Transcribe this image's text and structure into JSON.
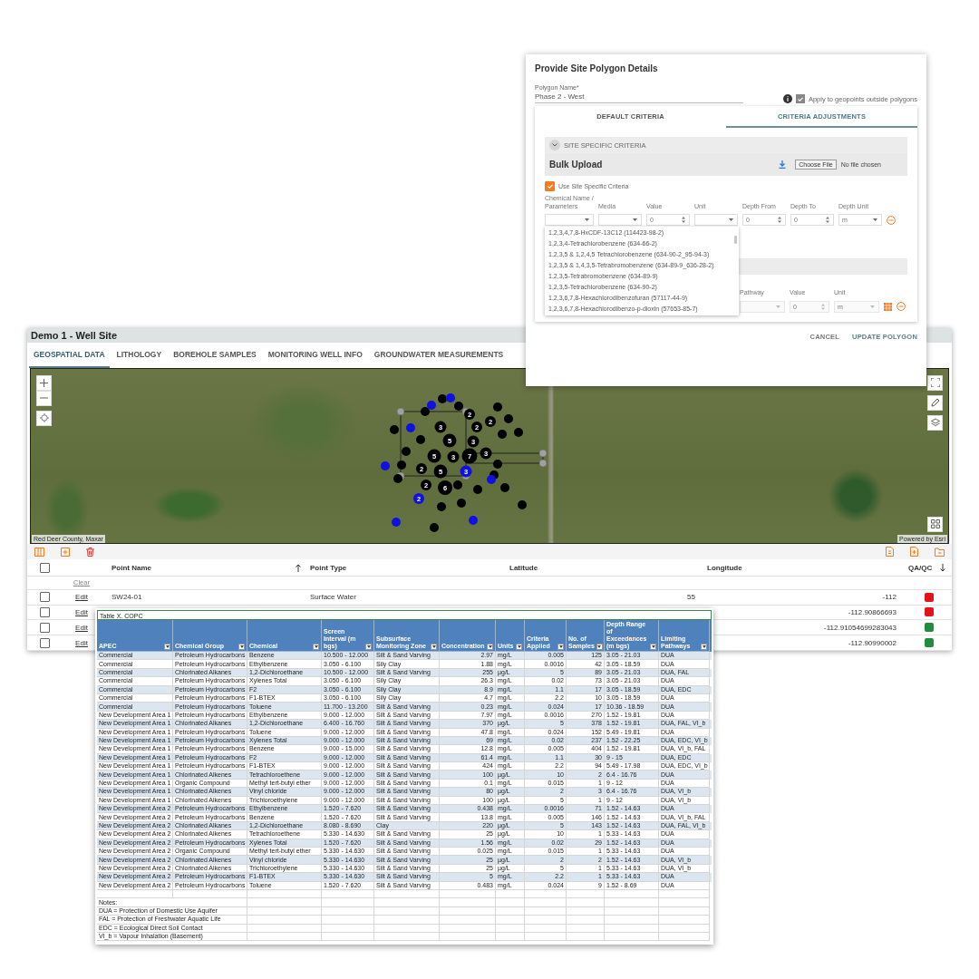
{
  "app": {
    "title": "Demo 1 - Well Site",
    "tabs": [
      {
        "label": "GEOSPATIAL DATA",
        "selected": true
      },
      {
        "label": "LITHOLOGY",
        "selected": false
      },
      {
        "label": "BOREHOLE SAMPLES",
        "selected": false
      },
      {
        "label": "MONITORING WELL INFO",
        "selected": false
      },
      {
        "label": "GROUNDWATER MEASUREMENTS",
        "selected": false
      }
    ],
    "map": {
      "attribution": "Red Deer County, Maxar",
      "credit": "Powered by Esri",
      "clusters": [
        {
          "count": "2",
          "color": "#000000"
        },
        {
          "count": "2",
          "color": "#000000"
        },
        {
          "count": "2",
          "color": "#000000"
        },
        {
          "count": "3",
          "color": "#000000"
        },
        {
          "count": "5",
          "color": "#000000"
        },
        {
          "count": "3",
          "color": "#000000"
        },
        {
          "count": "5",
          "color": "#000000"
        },
        {
          "count": "3",
          "color": "#000000"
        },
        {
          "count": "7",
          "color": "#000000"
        },
        {
          "count": "3",
          "color": "#000000"
        },
        {
          "count": "2",
          "color": "#000000"
        },
        {
          "count": "5",
          "color": "#000000"
        },
        {
          "count": "3",
          "color": "#1010e0"
        },
        {
          "count": "2",
          "color": "#000000"
        },
        {
          "count": "6",
          "color": "#000000"
        },
        {
          "count": "2",
          "color": "#1010e0"
        }
      ]
    },
    "table": {
      "select_all": {
        "checked": false
      },
      "columns": [
        "Point Name",
        "Point Type",
        "Latitude",
        "Longitude",
        "QA/QC"
      ],
      "filter_link": "Clear",
      "rows": [
        {
          "checked": false,
          "action": "Edit",
          "point_name": "SW24-01",
          "point_type": "Surface Water",
          "latitude": "55",
          "longitude": "-112",
          "color": "#e3131b"
        },
        {
          "checked": false,
          "action": "Edit",
          "longitude": "-112.90866693",
          "color": "#e3131b"
        },
        {
          "checked": false,
          "action": "Edit",
          "longitude": "-112.91054699283043",
          "color": "#1e8e3e"
        },
        {
          "checked": false,
          "action": "Edit",
          "longitude": "-112.90990002",
          "color": "#1e8e3e"
        }
      ]
    }
  },
  "dialog": {
    "title": "Provide Site Polygon Details",
    "polygon_name": {
      "label": "Polygon Name*",
      "value": "Phase 2 - West"
    },
    "apply_outside": {
      "label": "Apply to geopoints outside polygons",
      "checked": true
    },
    "tabs": [
      {
        "label": "DEFAULT CRITERIA",
        "selected": false
      },
      {
        "label": "CRITERIA ADJUSTMENTS",
        "selected": true
      }
    ],
    "section": {
      "title": "SITE SPECIFIC CRITERIA",
      "expanded": true
    },
    "bulk_upload": {
      "title": "Bulk Upload",
      "file_button": "Choose File",
      "file_status": "No file chosen"
    },
    "use_criteria": {
      "label": "Use Site Specific Criteria",
      "checked": true
    },
    "criteria_columns": [
      "Chemical Name / Parameters",
      "Media",
      "Value",
      "Unit",
      "Depth From",
      "Depth To",
      "Depth Unit"
    ],
    "criteria_row": {
      "value": "0",
      "depth_from": "0",
      "depth_to": "0",
      "depth_unit": "m"
    },
    "dropdown_options": [
      "1,2,3,4,7,8-HxCDF-13C12 (114423-98-2)",
      "1,2,3,4-Tetrachlorobenzene (634-66-2)",
      "1,2,3,5 & 1,2,4,5 Tetrachlorobenzene (634-90-2_95-94-3)",
      "1,2,3,5 & 1,4,3,5-Tetrabromobenzene (634-89-9_636-28-2)",
      "1,2,3,5-Tetrabromobenzene (634-89-9)",
      "1,2,3,5-Tetrachlorobenzene (634-90-2)",
      "1,2,3,6,7,8-Hexachlorodibenzofuran (57117-44-9)",
      "1,2,3,6,7,8-Hexachlorodibenzo-p-dioxin (57653-85-7)"
    ],
    "pathway_columns": [
      "Pathway",
      "Value",
      "Unit"
    ],
    "pathway_row": {
      "value": "0",
      "unit": "m"
    },
    "actions": [
      "CANCEL",
      "UPDATE POLYGON"
    ]
  },
  "spreadsheet": {
    "title": "Table X. COPC",
    "columns": [
      "APEC",
      "Chemical Group",
      "Chemical",
      "Screen Interval (m bgs)",
      "Subsurface Monitoring Zone",
      "Concentration",
      "Units",
      "Criteria Applied",
      "No. of Samples",
      "Depth Range of Exceedances (m bgs)",
      "Limiting Pathways"
    ],
    "rows": [
      [
        "Commercial",
        "Petroleum Hydrocarbons",
        "Benzene",
        "10.500 - 12.000",
        "Silt & Sand Varving",
        "2.97",
        "mg/L",
        "0.005",
        "125",
        "3.05 - 21.03",
        "DUA"
      ],
      [
        "Commercial",
        "Petroleum Hydrocarbons",
        "Ethylbenzene",
        "3.050 - 6.100",
        "Sily Clay",
        "1.88",
        "mg/L",
        "0.0016",
        "42",
        "3.05 - 18.59",
        "DUA"
      ],
      [
        "Commercial",
        "Chlorinated Alkanes",
        "1,2-Dichloroethane",
        "10.500 - 12.000",
        "Silt & Sand Varving",
        "255",
        "µg/L",
        "5",
        "89",
        "3.05 - 21.03",
        "DUA, FAL"
      ],
      [
        "Commercial",
        "Petroleum Hydrocarbons",
        "Xylenes Total",
        "3.050 - 6.100",
        "Sily Clay",
        "26.3",
        "mg/L",
        "0.02",
        "73",
        "3.05 - 21.03",
        "DUA"
      ],
      [
        "Commercial",
        "Petroleum Hydrocarbons",
        "F2",
        "3.050 - 6.100",
        "Sily Clay",
        "8.9",
        "mg/L",
        "1.1",
        "17",
        "3.05 - 18.59",
        "DUA, EDC"
      ],
      [
        "Commercial",
        "Petroleum Hydrocarbons",
        "F1-BTEX",
        "3.050 - 6.100",
        "Sily Clay",
        "4.7",
        "mg/L",
        "2.2",
        "10",
        "3.05 - 18.59",
        "DUA"
      ],
      [
        "Commercial",
        "Petroleum Hydrocarbons",
        "Toluene",
        "11.700 - 13.200",
        "Silt & Sand Varving",
        "0.23",
        "mg/L",
        "0.024",
        "17",
        "10.36 - 18.59",
        "DUA"
      ],
      [
        "New Development Area 1",
        "Petroleum Hydrocarbons",
        "Ethylbenzene",
        "9.000 - 12.000",
        "Silt & Sand Varving",
        "7.97",
        "mg/L",
        "0.0016",
        "270",
        "1.52 - 19.81",
        "DUA"
      ],
      [
        "New Development Area 1",
        "Chlorinated Alkanes",
        "1,2-Dichloroethane",
        "6.400 - 16.760",
        "Silt & Sand Varving",
        "370",
        "µg/L",
        "5",
        "378",
        "1.52 - 19.81",
        "DUA, FAL, VI_b"
      ],
      [
        "New Development Area 1",
        "Petroleum Hydrocarbons",
        "Toluene",
        "9.000 - 12.000",
        "Silt & Sand Varving",
        "47.8",
        "mg/L",
        "0.024",
        "152",
        "5.49 - 19.81",
        "DUA"
      ],
      [
        "New Development Area 1",
        "Petroleum Hydrocarbons",
        "Xylenes Total",
        "9.000 - 12.000",
        "Silt & Sand Varving",
        "69",
        "mg/L",
        "0.02",
        "237",
        "1.52 - 22.25",
        "DUA, EDC, VI_b"
      ],
      [
        "New Development Area 1",
        "Petroleum Hydrocarbons",
        "Benzene",
        "9.000 - 15.000",
        "Silt & Sand Varving",
        "12.8",
        "mg/L",
        "0.005",
        "404",
        "1.52 - 19.81",
        "DUA, VI_b, FAL"
      ],
      [
        "New Development Area 1",
        "Petroleum Hydrocarbons",
        "F2",
        "9.000 - 12.000",
        "Silt & Sand Varving",
        "61.4",
        "mg/L",
        "1.1",
        "30",
        "9 - 15",
        "DUA, EDC"
      ],
      [
        "New Development Area 1",
        "Petroleum Hydrocarbons",
        "F1-BTEX",
        "9.000 - 12.000",
        "Silt & Sand Varving",
        "424",
        "mg/L",
        "2.2",
        "94",
        "5.49 - 17.98",
        "DUA, EDC, VI_b"
      ],
      [
        "New Development Area 1",
        "Chlorinated Alkenes",
        "Tetrachloroethene",
        "9.000 - 12.000",
        "Silt & Sand Varving",
        "100",
        "µg/L",
        "10",
        "2",
        "6.4 - 16.76",
        "DUA"
      ],
      [
        "New Development Area 1",
        "Organic Compound",
        "Methyl tert-butyl ether",
        "9.000 - 12.000",
        "Silt & Sand Varving",
        "0.1",
        "mg/L",
        "0.015",
        "1",
        "9 - 12",
        "DUA"
      ],
      [
        "New Development Area 1",
        "Chlorinated Alkenes",
        "Vinyl chloride",
        "9.000 - 12.000",
        "Silt & Sand Varving",
        "80",
        "µg/L",
        "2",
        "3",
        "6.4 - 16.76",
        "DUA, VI_b"
      ],
      [
        "New Development Area 1",
        "Chlorinated Alkenes",
        "Trichloroethylene",
        "9.000 - 12.000",
        "Silt & Sand Varving",
        "100",
        "µg/L",
        "5",
        "1",
        "9 - 12",
        "DUA, VI_b"
      ],
      [
        "New Development Area 2",
        "Petroleum Hydrocarbons",
        "Ethylbenzene",
        "1.520 - 7.620",
        "Silt & Sand Varving",
        "0.438",
        "mg/L",
        "0.0016",
        "71",
        "1.52 - 14.63",
        "DUA"
      ],
      [
        "New Development Area 2",
        "Petroleum Hydrocarbons",
        "Benzene",
        "1.520 - 7.620",
        "Silt & Sand Varving",
        "13.8",
        "mg/L",
        "0.005",
        "146",
        "1.52 - 14.63",
        "DUA, VI_b, FAL"
      ],
      [
        "New Development Area 2",
        "Chlorinated Alkanes",
        "1,2-Dichloroethane",
        "8.080 - 8.690",
        "Clay",
        "220",
        "µg/L",
        "5",
        "143",
        "1.52 - 14.63",
        "DUA, FAL, VI_b"
      ],
      [
        "New Development Area 2",
        "Chlorinated Alkenes",
        "Tetrachloroethene",
        "5.330 - 14.630",
        "Silt & Sand Varving",
        "25",
        "µg/L",
        "10",
        "1",
        "5.33 - 14.63",
        "DUA"
      ],
      [
        "New Development Area 2",
        "Petroleum Hydrocarbons",
        "Xylenes Total",
        "1.520 - 7.620",
        "Silt & Sand Varving",
        "1.56",
        "mg/L",
        "0.02",
        "29",
        "1.52 - 14.63",
        "DUA"
      ],
      [
        "New Development Area 2",
        "Organic Compound",
        "Methyl tert-butyl ether",
        "5.330 - 14.630",
        "Silt & Sand Varving",
        "0.025",
        "mg/L",
        "0.015",
        "1",
        "5.33 - 14.63",
        "DUA"
      ],
      [
        "New Development Area 2",
        "Chlorinated Alkenes",
        "Vinyl chloride",
        "5.330 - 14.630",
        "Silt & Sand Varving",
        "25",
        "µg/L",
        "2",
        "2",
        "1.52 - 14.63",
        "DUA, VI_b"
      ],
      [
        "New Development Area 2",
        "Chlorinated Alkenes",
        "Trichloroethylene",
        "5.330 - 14.630",
        "Silt & Sand Varving",
        "25",
        "µg/L",
        "5",
        "1",
        "5.33 - 14.63",
        "DUA, VI_b"
      ],
      [
        "New Development Area 2",
        "Petroleum Hydrocarbons",
        "F1-BTEX",
        "5.330 - 14.630",
        "Silt & Sand Varving",
        "5",
        "mg/L",
        "2.2",
        "1",
        "5.33 - 14.63",
        "DUA"
      ],
      [
        "New Development Area 2",
        "Petroleum Hydrocarbons",
        "Toluene",
        "1.520 - 7.620",
        "Silt & Sand Varving",
        "0.483",
        "mg/L",
        "0.024",
        "9",
        "1.52 - 8.69",
        "DUA"
      ]
    ],
    "notes": [
      "Notes:",
      "DUA = Protection of Domestic Use Aquifer",
      "FAL = Protection of Freshwater Aquatic Life",
      "EDC = Ecological Direct Soil Contact",
      "VI_b = Vapour Inhalation (Basement)"
    ]
  }
}
